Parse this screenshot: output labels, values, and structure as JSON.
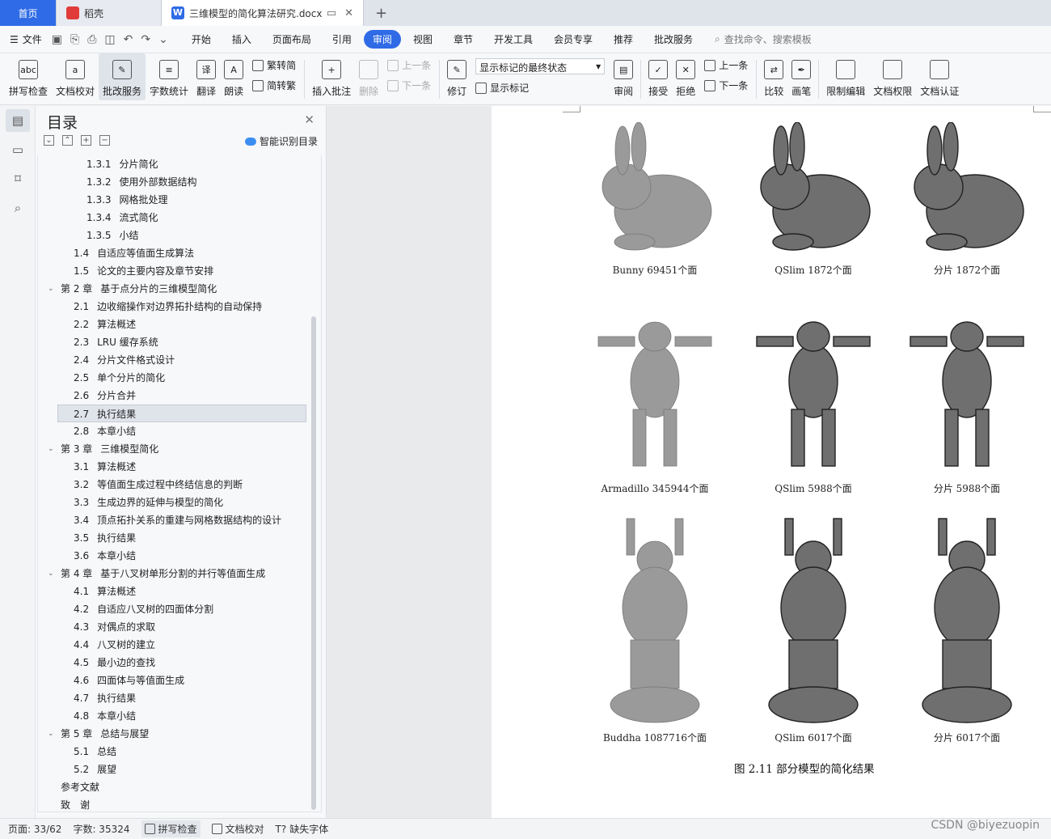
{
  "tabs": {
    "home": "首页",
    "daoke": "稻壳",
    "document": "三维模型的简化算法研究.docx"
  },
  "menubar": {
    "file": "文件",
    "items": [
      "开始",
      "插入",
      "页面布局",
      "引用",
      "审阅",
      "视图",
      "章节",
      "开发工具",
      "会员专享",
      "推荐",
      "批改服务"
    ],
    "active": "审阅",
    "search_placeholder": "查找命令、搜索模板"
  },
  "ribbon": {
    "spell": "拼写检查",
    "proof": "文档校对",
    "correct": "批改服务",
    "wordcount": "字数统计",
    "translate": "翻译",
    "read": "朗读",
    "to_traditional": "繁转简",
    "to_simplified": "简转繁",
    "insert_comment": "插入批注",
    "delete": "删除",
    "prev": "上一条",
    "next": "下一条",
    "revise": "修订",
    "markup_state": "显示标记的最终状态",
    "show_markup": "显示标记",
    "review": "审阅",
    "accept": "接受",
    "reject": "拒绝",
    "prev2": "上一条",
    "next2": "下一条",
    "compare": "比较",
    "pen": "画笔",
    "restrict": "限制编辑",
    "permission": "文档权限",
    "certify": "文档认证"
  },
  "toc": {
    "title": "目录",
    "smart": "智能识别目录",
    "items": [
      {
        "level": 3,
        "num": "1.3.1",
        "text": "分片简化"
      },
      {
        "level": 3,
        "num": "1.3.2",
        "text": "使用外部数据结构"
      },
      {
        "level": 3,
        "num": "1.3.3",
        "text": "网格批处理"
      },
      {
        "level": 3,
        "num": "1.3.4",
        "text": "流式简化"
      },
      {
        "level": 3,
        "num": "1.3.5",
        "text": "小结"
      },
      {
        "level": 2,
        "num": "1.4",
        "text": "自适应等值面生成算法"
      },
      {
        "level": 2,
        "num": "1.5",
        "text": "论文的主要内容及章节安排"
      },
      {
        "level": 1,
        "num": "第 2 章",
        "text": "基于点分片的三维模型简化"
      },
      {
        "level": 2,
        "num": "2.1",
        "text": "边收缩操作对边界拓扑结构的自动保持"
      },
      {
        "level": 2,
        "num": "2.2",
        "text": "算法概述"
      },
      {
        "level": 2,
        "num": "2.3",
        "text": "LRU 缓存系统"
      },
      {
        "level": 2,
        "num": "2.4",
        "text": "分片文件格式设计"
      },
      {
        "level": 2,
        "num": "2.5",
        "text": "单个分片的简化"
      },
      {
        "level": 2,
        "num": "2.6",
        "text": "分片合并"
      },
      {
        "level": 2,
        "num": "2.7",
        "text": "执行结果"
      },
      {
        "level": 2,
        "num": "2.8",
        "text": "本章小结"
      },
      {
        "level": 1,
        "num": "第 3 章",
        "text": "三维模型简化"
      },
      {
        "level": 2,
        "num": "3.1",
        "text": "算法概述"
      },
      {
        "level": 2,
        "num": "3.2",
        "text": "等值面生成过程中终结信息的判断"
      },
      {
        "level": 2,
        "num": "3.3",
        "text": "生成边界的延伸与模型的简化"
      },
      {
        "level": 2,
        "num": "3.4",
        "text": "顶点拓扑关系的重建与网格数据结构的设计"
      },
      {
        "level": 2,
        "num": "3.5",
        "text": "执行结果"
      },
      {
        "level": 2,
        "num": "3.6",
        "text": "本章小结"
      },
      {
        "level": 1,
        "num": "第 4 章",
        "text": "基于八叉树单形分割的并行等值面生成"
      },
      {
        "level": 2,
        "num": "4.1",
        "text": "算法概述"
      },
      {
        "level": 2,
        "num": "4.2",
        "text": "自适应八叉树的四面体分割"
      },
      {
        "level": 2,
        "num": "4.3",
        "text": "对偶点的求取"
      },
      {
        "level": 2,
        "num": "4.4",
        "text": "八叉树的建立"
      },
      {
        "level": 2,
        "num": "4.5",
        "text": "最小边的查找"
      },
      {
        "level": 2,
        "num": "4.6",
        "text": "四面体与等值面生成"
      },
      {
        "level": 2,
        "num": "4.7",
        "text": "执行结果"
      },
      {
        "level": 2,
        "num": "4.8",
        "text": "本章小结"
      },
      {
        "level": 1,
        "num": "第 5 章",
        "text": "总结与展望"
      },
      {
        "level": 2,
        "num": "5.1",
        "text": "总结"
      },
      {
        "level": 2,
        "num": "5.2",
        "text": "展望"
      },
      {
        "level": 0,
        "num": "",
        "text": "参考文献"
      },
      {
        "level": 0,
        "num": "",
        "text": "致　谢"
      }
    ],
    "selected_index": 14
  },
  "figure": {
    "rows": [
      [
        "Bunny 69451个面",
        "QSlim 1872个面",
        "分片  1872个面"
      ],
      [
        "Armadillo  345944个面",
        "QSlim  5988个面",
        "分片  5988个面"
      ],
      [
        "Buddha 1087716个面",
        "QSlim 6017个面",
        "分片 6017个面"
      ]
    ],
    "title": "图 2.11  部分模型的简化结果"
  },
  "status": {
    "page": "页面: 33/62",
    "words": "字数: 35324",
    "spell": "拼写检查",
    "proof": "文档校对",
    "missing_font": "缺失字体"
  },
  "watermark": "CSDN @biyezuopin"
}
